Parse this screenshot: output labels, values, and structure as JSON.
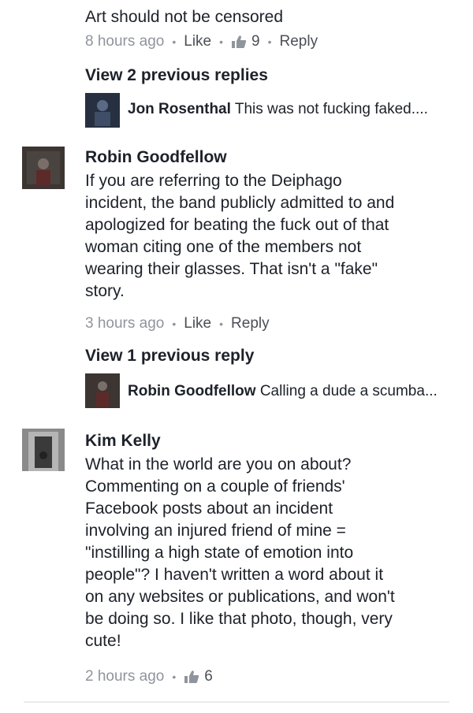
{
  "comments": {
    "top": {
      "text": "Art should not be censored",
      "time": "8 hours ago",
      "like_label": "Like",
      "likes": "9",
      "reply_label": "Reply"
    },
    "view_prev_1": "View 2 previous replies",
    "reply_preview_1": {
      "author": "Jon Rosenthal",
      "text": "This was not fucking faked...."
    },
    "robin": {
      "author": "Robin Goodfellow",
      "lines": [
        "If you are referring to the Deiphago",
        "incident, the band publicly admitted to and",
        "apologized for beating the fuck out of that",
        "woman citing one of the members not",
        "wearing their glasses. That isn't a \"fake\"",
        "story."
      ],
      "time": "3 hours ago",
      "like_label": "Like",
      "reply_label": "Reply"
    },
    "view_prev_2": "View 1 previous reply",
    "reply_preview_2": {
      "author": "Robin Goodfellow",
      "text": "Calling a dude a scumba..."
    },
    "kim": {
      "author": "Kim Kelly",
      "lines": [
        "What in the world are you on about?",
        "Commenting on a couple of friends'",
        "Facebook posts about an incident",
        "involving an injured friend of mine =",
        "\"instilling a high state of emotion into",
        "people\"? I haven't written a word about it",
        "on any websites or publications, and won't",
        "be doing so. I like that photo, though, very",
        "cute!"
      ],
      "time": "2 hours ago",
      "likes": "6"
    }
  },
  "colors": {
    "meta": "#90949c",
    "text": "#1d2129",
    "link": "#4b4f56"
  },
  "icons": {
    "thumb": "thumbs-up-icon"
  }
}
